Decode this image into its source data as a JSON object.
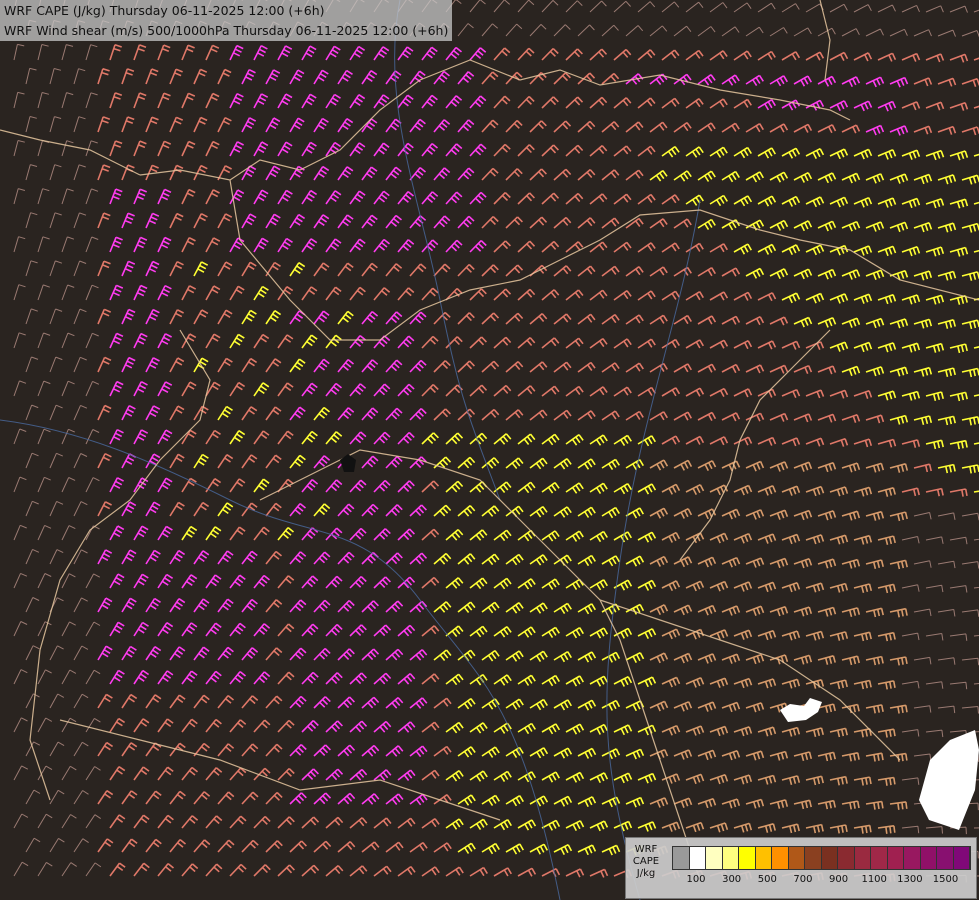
{
  "title": {
    "line1": "WRF CAPE (J/kg) Thursday 06-11-2025 12:00 (+6h)",
    "line2": "WRF Wind shear (m/s) 500/1000hPa Thursday 06-11-2025 12:00 (+6h)"
  },
  "legend": {
    "title_lines": [
      "WRF",
      "CAPE",
      "J/kg"
    ],
    "colors": [
      "#9a9a9a",
      "#ffffff",
      "#ffffc0",
      "#ffff80",
      "#ffff00",
      "#ffc000",
      "#ff9000",
      "#b05818",
      "#8a4020",
      "#7a3020",
      "#8a2a30",
      "#9a2a40",
      "#a02848",
      "#a02050",
      "#981860",
      "#901068",
      "#881070",
      "#800878"
    ],
    "tick_labels": [
      "100",
      "300",
      "500",
      "700",
      "900",
      "1100",
      "1300",
      "1500"
    ]
  },
  "colors": {
    "background": "#2a2420",
    "barb_low": "#9a7a72",
    "barb_mid": "#e07868",
    "barb_high": "#ff3cf0",
    "barb_vhigh": "#ffff33",
    "barb_tan": "#d69a6a",
    "border": "#e8c8a0",
    "river": "#4a6aa0"
  }
}
